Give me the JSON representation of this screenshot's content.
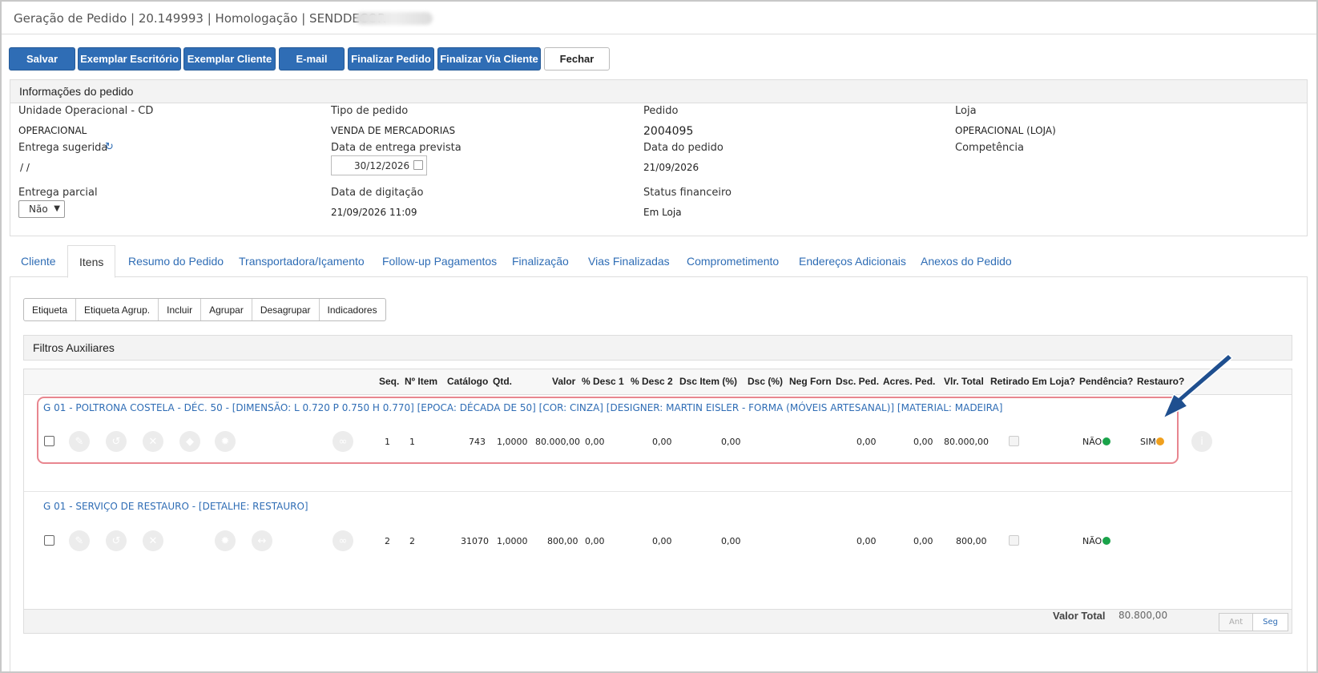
{
  "window": {
    "title": "Geração de Pedido | 20.149993 | Homologação | SENDDECOR"
  },
  "toolbar": {
    "salvar": "Salvar",
    "exemplar_escritorio": "Exemplar Escritório",
    "exemplar_cliente": "Exemplar Cliente",
    "email": "E-mail",
    "finalizar_pedido": "Finalizar Pedido",
    "finalizar_via_cliente": "Finalizar Via Cliente",
    "fechar": "Fechar"
  },
  "info": {
    "header": "Informações do pedido",
    "unidade_label": "Unidade Operacional - CD",
    "unidade_value": "OPERACIONAL",
    "tipo_label": "Tipo de pedido",
    "tipo_value": "VENDA DE MERCADORIAS",
    "pedido_label": "Pedido",
    "pedido_value": "2004095",
    "loja_label": "Loja",
    "loja_value": "OPERACIONAL (LOJA)",
    "entrega_sugerida_label": "Entrega sugerida",
    "entrega_sugerida_value": "/ /",
    "data_entrega_label": "Data de entrega prevista",
    "data_entrega_value": "30/12/2026",
    "data_pedido_label": "Data do pedido",
    "data_pedido_value": "21/09/2026",
    "competencia_label": "Competência",
    "entrega_parcial_label": "Entrega parcial",
    "entrega_parcial_value": "Não",
    "data_digitacao_label": "Data de digitação",
    "data_digitacao_value": "21/09/2026 11:09",
    "status_fin_label": "Status financeiro",
    "status_fin_value": "Em Loja"
  },
  "tabs": [
    "Cliente",
    "Itens",
    "Resumo do Pedido",
    "Transportadora/Içamento",
    "Follow-up Pagamentos",
    "Finalização",
    "Vias Finalizadas",
    "Comprometimento",
    "Endereços Adicionais",
    "Anexos do Pedido"
  ],
  "item_toolbar": [
    "Etiqueta",
    "Etiqueta Agrup.",
    "Incluir",
    "Agrupar",
    "Desagrupar",
    "Indicadores"
  ],
  "filters_title": "Filtros Auxiliares",
  "grid": {
    "headers": [
      "Seq.",
      "Nº Item",
      "Catálogo",
      "Qtd.",
      "Valor",
      "% Desc 1",
      "% Desc 2",
      "Dsc Item (%)",
      "Dsc (%)",
      "Neg Forn",
      "Dsc. Ped.",
      "Acres. Ped.",
      "Vlr. Total",
      "Retirado Em Loja?",
      "Pendência?",
      "Restauro?"
    ],
    "rows": [
      {
        "title": "G 01 - POLTRONA COSTELA - DÉC. 50 - [DIMENSÃO: L 0.720 P 0.750 H 0.770] [EPOCA: DÉCADA DE 50] [COR: CINZA] [DESIGNER: MARTIN EISLER - FORMA (MÓVEIS ARTESANAL)] [MATERIAL: MADEIRA]",
        "seq": "1",
        "item": "1",
        "catalogo": "743",
        "qtd": "1,0000",
        "valor": "80.000,00",
        "desc1": "0,00",
        "desc2": "0,00",
        "dsc_item": "0,00",
        "dsc_ped": "0,00",
        "acres_ped": "0,00",
        "total": "80.000,00",
        "pendencia": "NÃO",
        "restauro": "SIM"
      },
      {
        "title": "G 01 - SERVIÇO DE RESTAURO - [DETALHE: RESTAURO]",
        "seq": "2",
        "item": "2",
        "catalogo": "31070",
        "qtd": "1,0000",
        "valor": "800,00",
        "desc1": "0,00",
        "desc2": "0,00",
        "dsc_item": "0,00",
        "dsc_ped": "0,00",
        "acres_ped": "0,00",
        "total": "800,00",
        "pendencia": "NÃO"
      }
    ],
    "pager_prev": "Ant",
    "pager_next": "Seg"
  },
  "totals": {
    "label": "Valor Total",
    "value": "80.800,00"
  },
  "colors": {
    "primary": "#2f6db5",
    "green": "#1aa34a",
    "orange": "#f0a01e",
    "highlight": "#e8868f",
    "arrow": "#1f4f8f"
  }
}
